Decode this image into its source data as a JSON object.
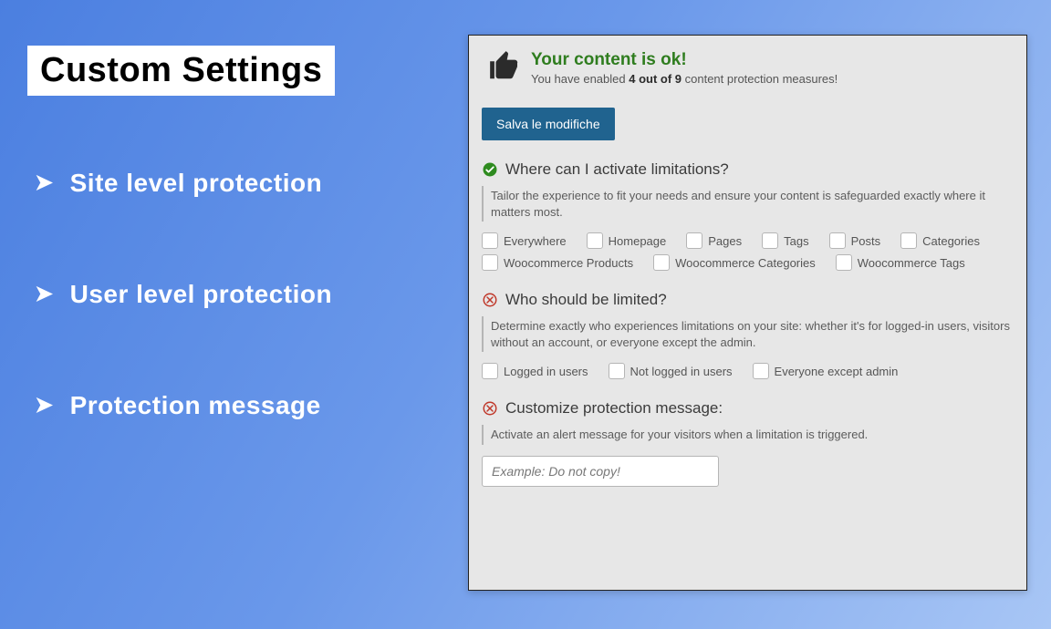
{
  "left": {
    "title": "Custom Settings",
    "bullets": [
      "Site level protection",
      "User level protection",
      "Protection message"
    ]
  },
  "panel": {
    "status": {
      "title": "Your content is ok!",
      "sub_pre": "You have enabled ",
      "sub_bold": "4 out of 9",
      "sub_post": " content protection measures!"
    },
    "save_label": "Salva le modifiche",
    "sections": {
      "where": {
        "icon": "check",
        "title": "Where can I activate limitations?",
        "desc": "Tailor the experience to fit your needs and ensure your content is safeguarded exactly where it matters most.",
        "items": [
          "Everywhere",
          "Homepage",
          "Pages",
          "Tags",
          "Posts",
          "Categories",
          "Woocommerce Products",
          "Woocommerce Categories",
          "Woocommerce Tags"
        ]
      },
      "who": {
        "icon": "cross",
        "title": "Who should be limited?",
        "desc": "Determine exactly who experiences limitations on your site: whether it's for logged-in users, visitors without an account, or everyone except the admin.",
        "items": [
          "Logged in users",
          "Not logged in users",
          "Everyone except admin"
        ]
      },
      "msg": {
        "icon": "cross",
        "title": "Customize protection message:",
        "desc": "Activate an alert message for your visitors when a limitation is triggered.",
        "placeholder": "Example: Do not copy!"
      }
    }
  }
}
